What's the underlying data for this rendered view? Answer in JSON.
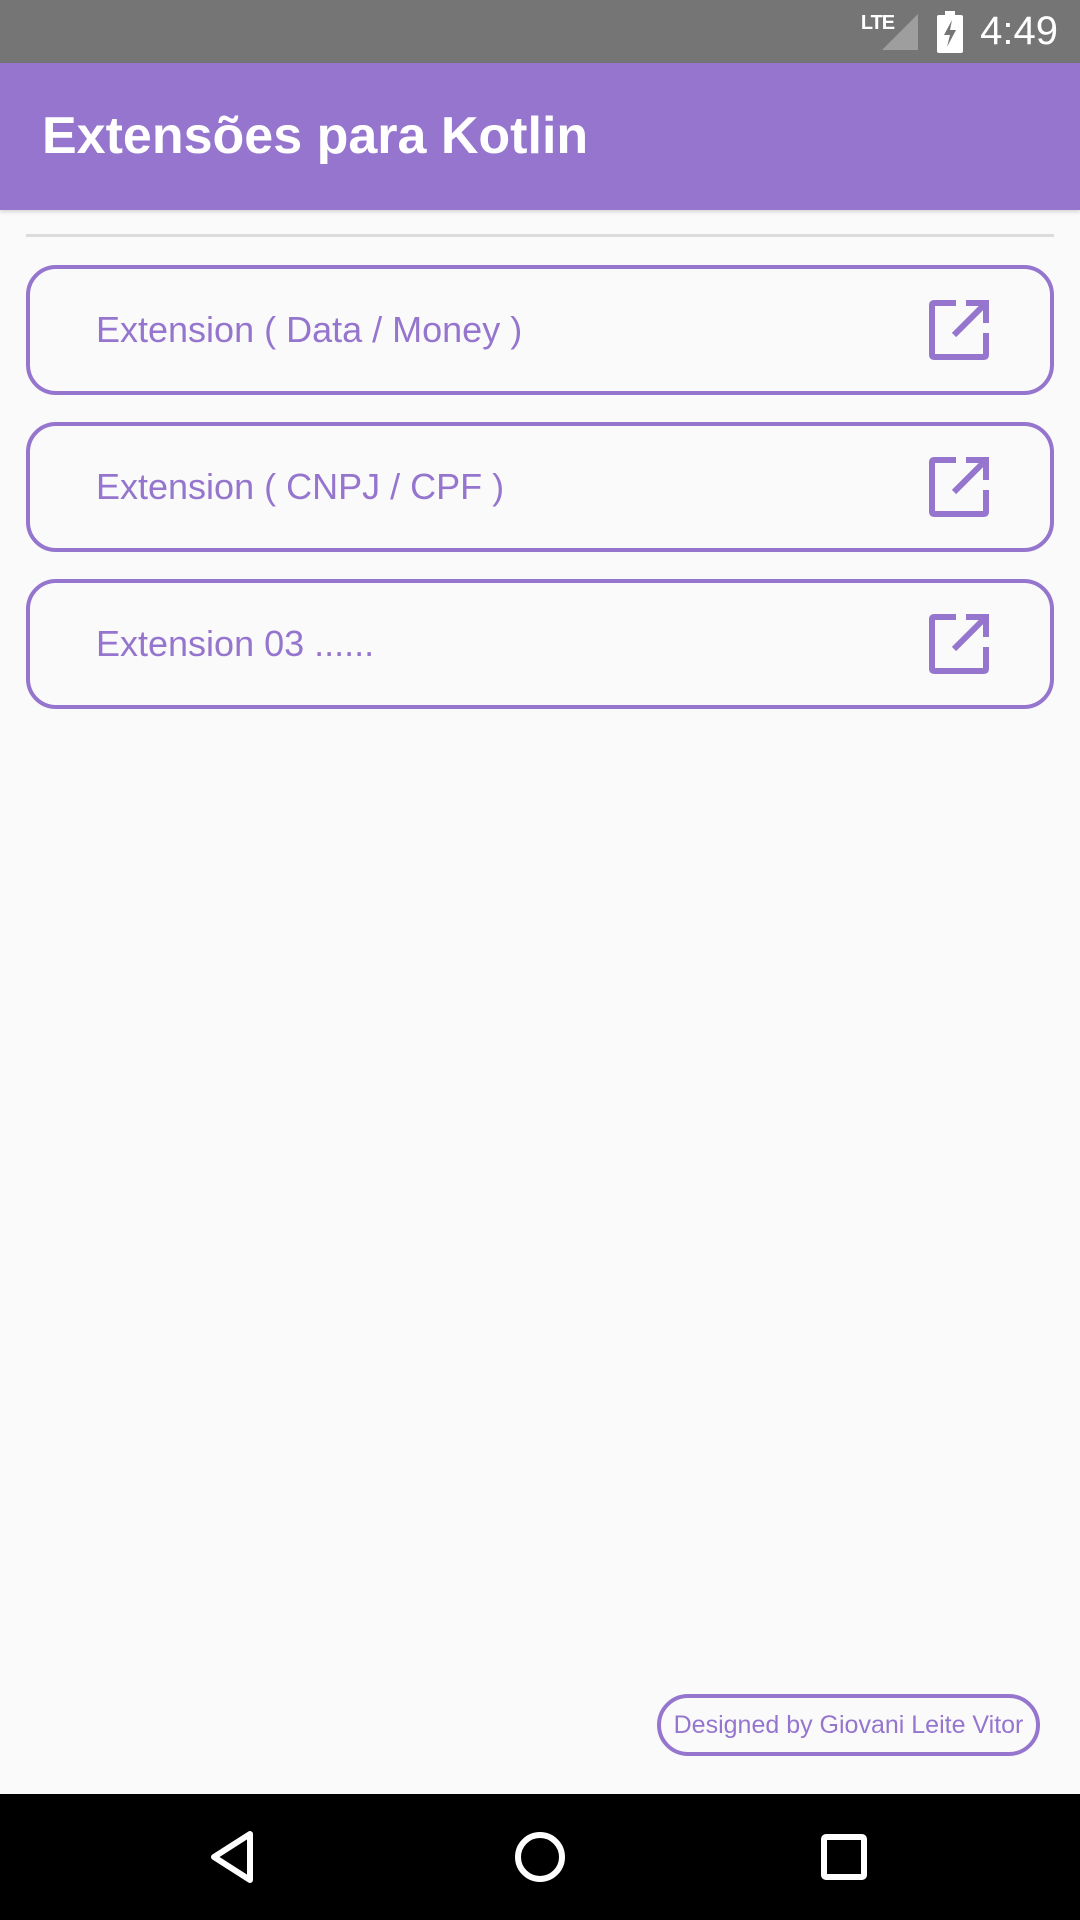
{
  "status_bar": {
    "network": "LTE",
    "time": "4:49",
    "icons": [
      "signal-icon",
      "battery-charging-icon"
    ]
  },
  "app_bar": {
    "title": "Extensões para Kotlin"
  },
  "extensions": {
    "items": [
      {
        "label": "Extension ( Data / Money )",
        "icon": "open-in-new-icon"
      },
      {
        "label": "Extension ( CNPJ / CPF )",
        "icon": "open-in-new-icon"
      },
      {
        "label": "Extension 03 ......",
        "icon": "open-in-new-icon"
      }
    ]
  },
  "footer": {
    "credit": "Designed by Giovani Leite Vitor"
  },
  "nav_bar": {
    "icons": [
      "back-icon",
      "home-icon",
      "recents-icon"
    ]
  },
  "colors": {
    "accent": "#9575cd",
    "status_bar": "#757575",
    "background": "#fafafa",
    "nav_bar": "#000000"
  }
}
